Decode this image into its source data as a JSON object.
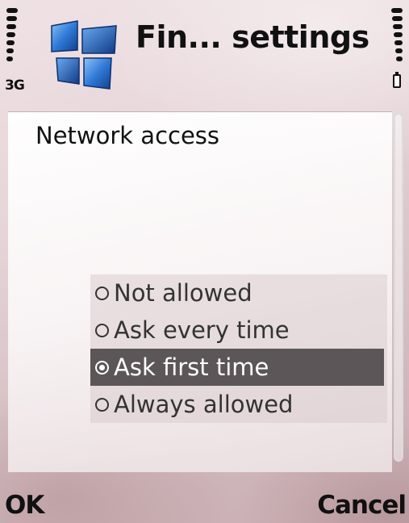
{
  "status": {
    "network_type": "3G",
    "signal_level": 7,
    "battery_level": 7
  },
  "header": {
    "title": "Fin... settings",
    "app_icon": "windows-logo-icon"
  },
  "panel": {
    "title": "Network access"
  },
  "options": [
    {
      "label": "Not allowed",
      "selected": false
    },
    {
      "label": "Ask every time",
      "selected": false
    },
    {
      "label": "Ask first time",
      "selected": true
    },
    {
      "label": "Always allowed",
      "selected": false
    }
  ],
  "softkeys": {
    "left": "OK",
    "right": "Cancel"
  },
  "colors": {
    "selection": "#5c5659",
    "logo_blue": "#1e5fb8"
  }
}
